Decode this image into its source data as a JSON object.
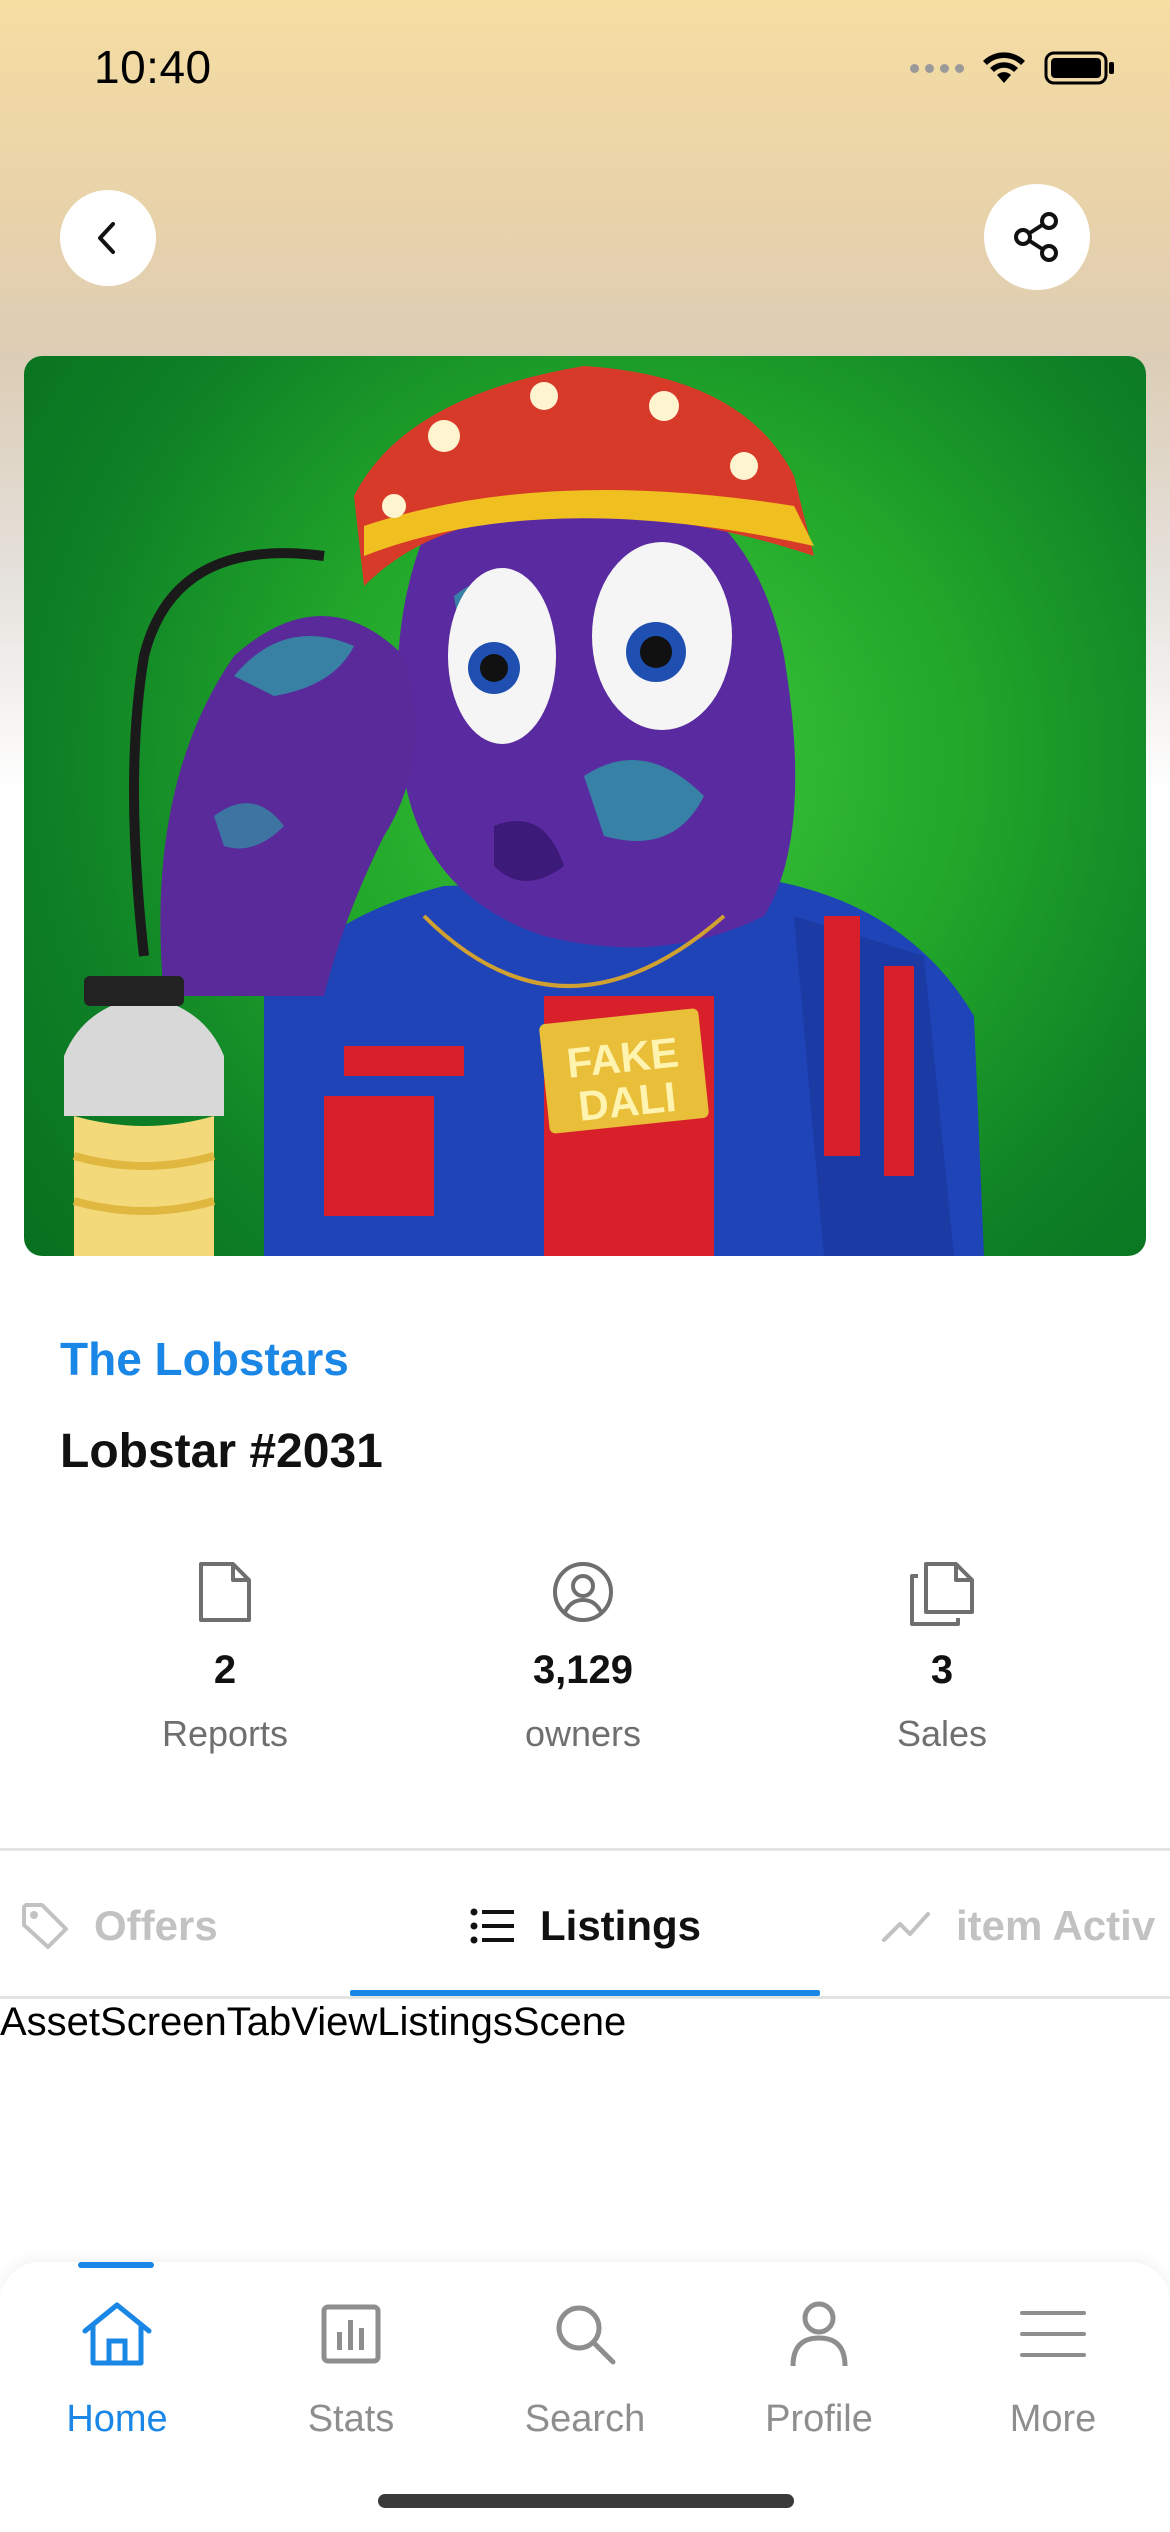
{
  "status_bar": {
    "time": "10:40"
  },
  "header": {
    "back_icon": "chevron-left-icon",
    "share_icon": "share-icon"
  },
  "asset": {
    "collection": "The Lobstars",
    "title": "Lobstar #2031",
    "image_text": "FAKE DALI"
  },
  "stats": [
    {
      "icon": "file-icon",
      "value": "2",
      "label": "Reports"
    },
    {
      "icon": "user-circle-icon",
      "value": "3,129",
      "label": "owners"
    },
    {
      "icon": "copy-icon",
      "value": "3",
      "label": "Sales"
    }
  ],
  "tabs": [
    {
      "icon": "tag-icon",
      "label": "Offers"
    },
    {
      "icon": "list-icon",
      "label": "Listings",
      "active": true
    },
    {
      "icon": "trending-icon",
      "label": "item Activ"
    }
  ],
  "tab_content": {
    "scene_label": "AssetScreenTabViewListingsScene"
  },
  "bottom_nav": [
    {
      "icon": "home-icon",
      "label": "Home",
      "active": true
    },
    {
      "icon": "bar-chart-icon",
      "label": "Stats"
    },
    {
      "icon": "search-icon",
      "label": "Search"
    },
    {
      "icon": "user-icon",
      "label": "Profile"
    },
    {
      "icon": "menu-icon",
      "label": "More"
    }
  ],
  "colors": {
    "accent": "#1a86e6",
    "muted": "#8e8e8e",
    "tab_inactive": "#c2c2c2"
  }
}
